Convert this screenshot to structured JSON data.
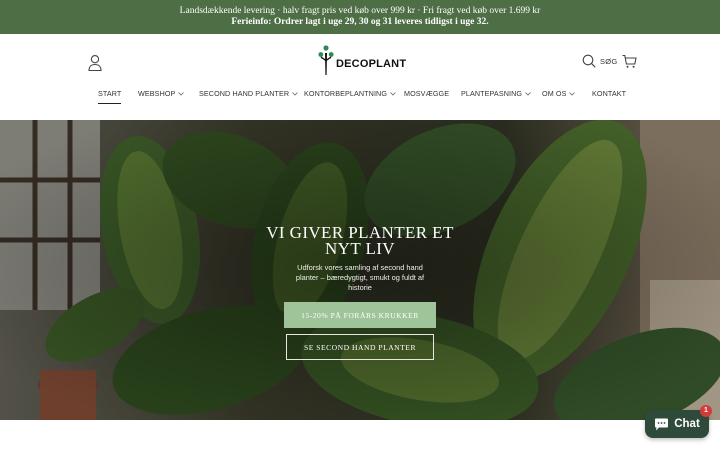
{
  "announcement": {
    "line1": "Landsdækkende levering · halv fragt pris ved køb over 999 kr · Fri fragt ved køb over 1.699 kr",
    "line2": "Ferieinfo: Ordrer lagt i uge 29, 30 og 31 leveres tidligst i uge 32."
  },
  "header": {
    "brand": "DECOPLANT",
    "search_label": "SØG",
    "icons": {
      "account": "user-icon",
      "search": "search-icon",
      "cart": "cart-icon"
    }
  },
  "nav": {
    "items": [
      {
        "label": "START",
        "active": true,
        "dropdown": false
      },
      {
        "label": "WEBSHOP",
        "active": false,
        "dropdown": true
      },
      {
        "label": "SECOND HAND PLANTER",
        "active": false,
        "dropdown": true
      },
      {
        "label": "KONTORBEPLANTNING",
        "active": false,
        "dropdown": true
      },
      {
        "label": "MOSVÆGGE",
        "active": false,
        "dropdown": false
      },
      {
        "label": "PLANTEPASNING",
        "active": false,
        "dropdown": true
      },
      {
        "label": "OM OS",
        "active": false,
        "dropdown": true
      },
      {
        "label": "KONTAKT",
        "active": false,
        "dropdown": false
      }
    ]
  },
  "hero": {
    "title": "VI GIVER PLANTER ET NYT LIV",
    "subtitle": "Udforsk vores samling af second hand planter – bæredygtigt, smukt og fuldt af historie",
    "primary_button": "15-20% PÅ FORÅRS KRUKKER",
    "secondary_button": "SE SECOND HAND PLANTER"
  },
  "chat": {
    "label": "Chat",
    "badge": "1",
    "icon": "chat-bubble-icon"
  },
  "colors": {
    "announcement_bg": "#4e6e45",
    "primary_button_bg": "#9fc49a",
    "logo_green": "#2f8a4f",
    "chat_bg": "#2e4a3a",
    "badge": "#d33b3b"
  }
}
